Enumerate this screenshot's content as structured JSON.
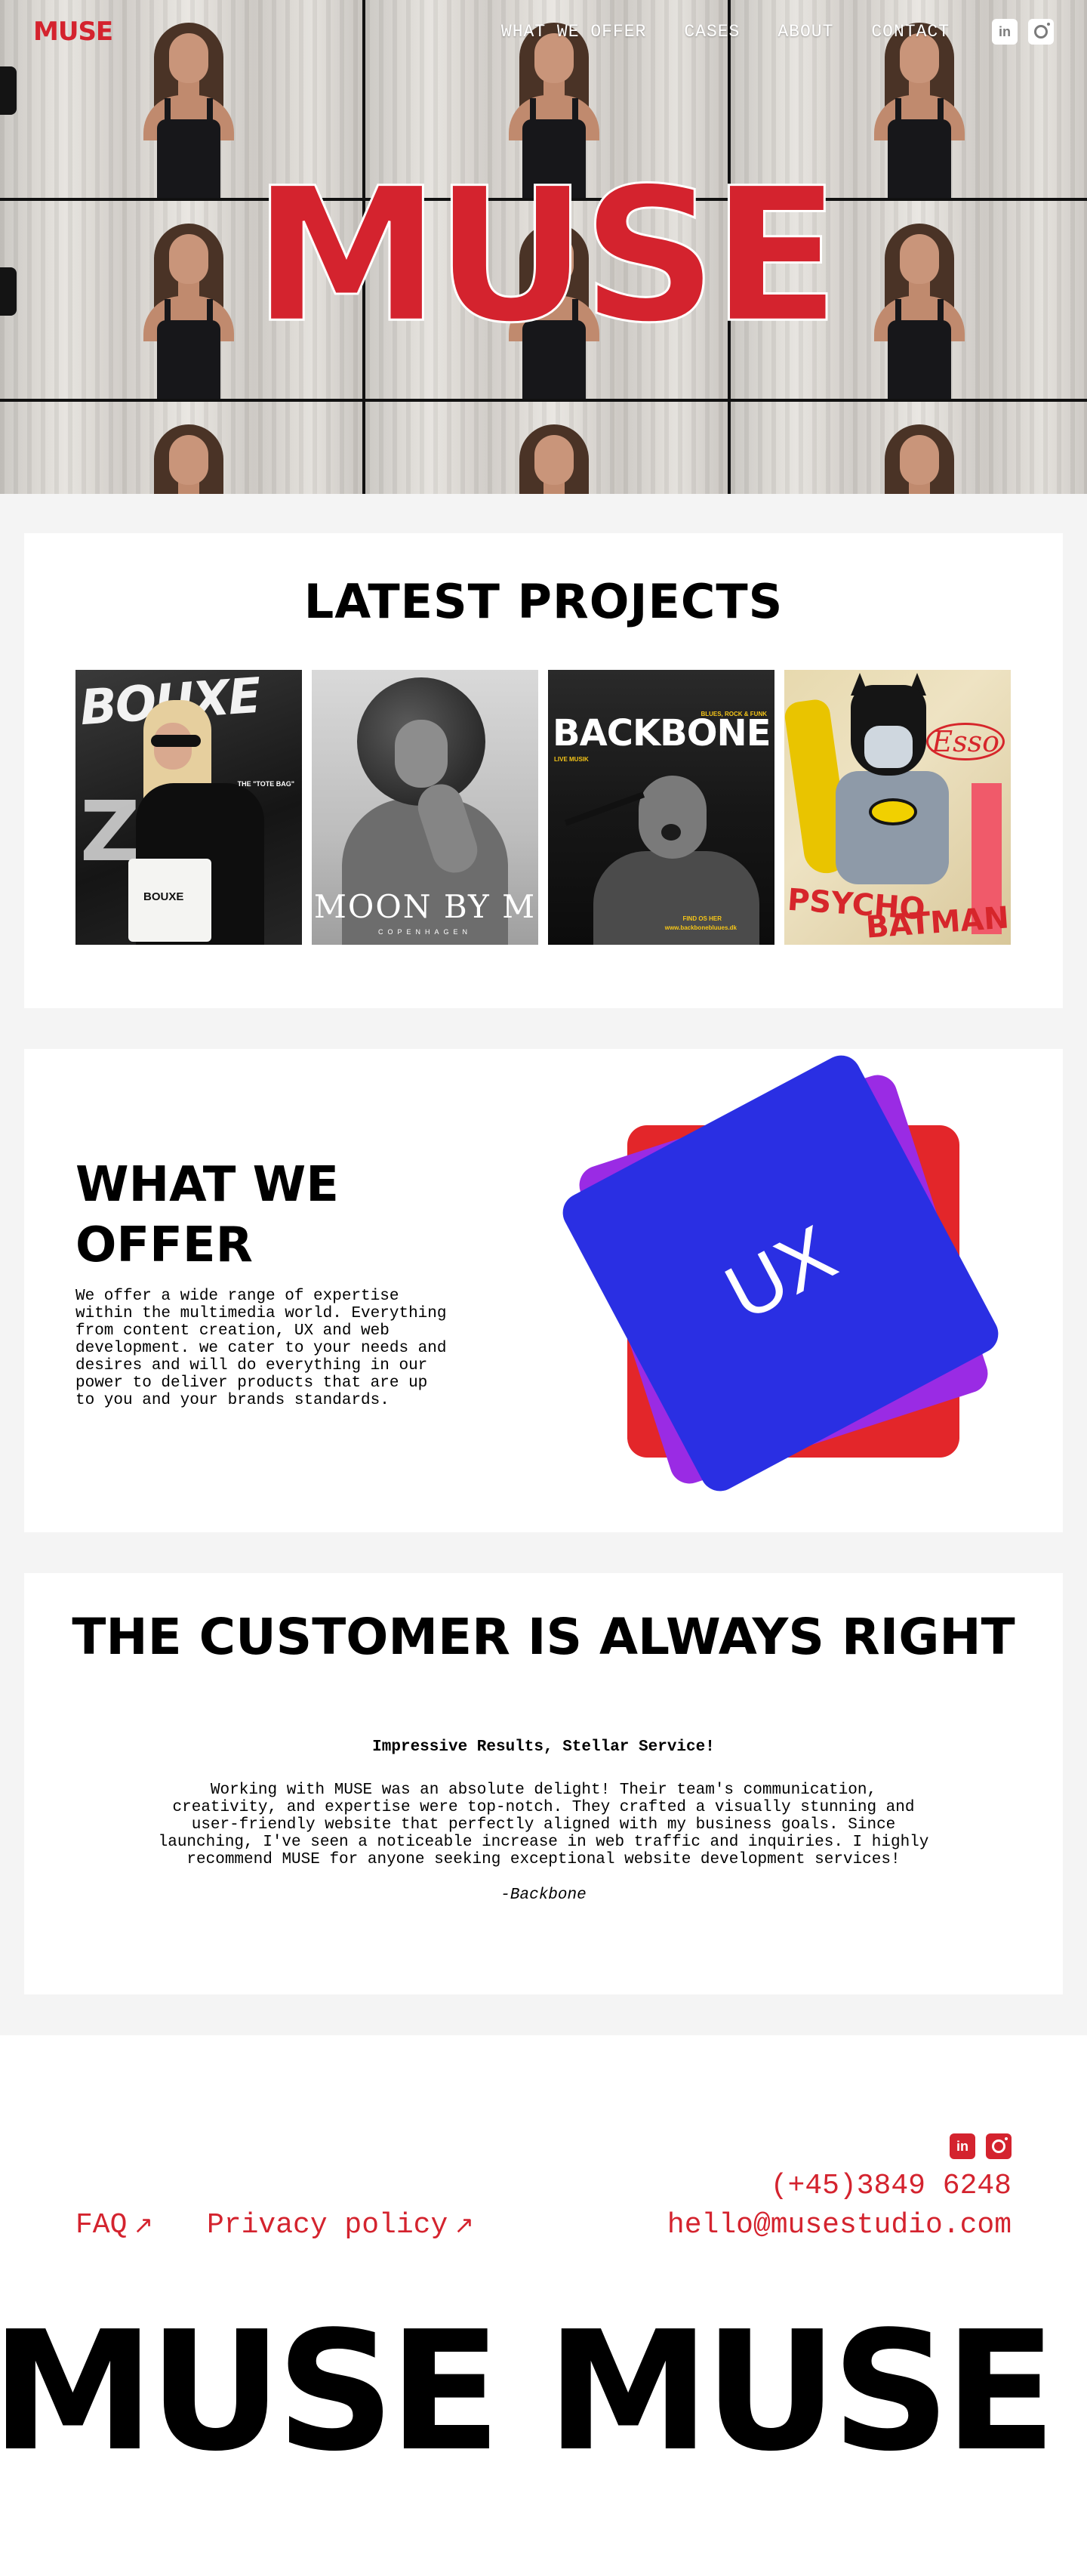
{
  "nav": {
    "logo": "MUSE",
    "links": [
      "WHAT WE OFFER",
      "CASES",
      "ABOUT",
      "CONTACT"
    ],
    "social_icons": [
      "linkedin-icon",
      "instagram-icon"
    ],
    "social_letters": [
      "in",
      ""
    ]
  },
  "hero": {
    "title": "MUSE"
  },
  "projects": {
    "title": "LATEST PROJECTS",
    "items": [
      {
        "name": "Bouxe",
        "big_text": "BOUXE",
        "bag_text": "BOUXE",
        "tag": "THE \"TOTE BAG\""
      },
      {
        "name": "Moon by M",
        "brand": "MOON BY M",
        "sub": "COPENHAGEN"
      },
      {
        "name": "Backbone",
        "title": "BACKBONE",
        "tag": "BLUES, ROCK & FUNK",
        "live": "LIVE MUSIK",
        "find": "FIND OS HER",
        "url": "www.backbonebluues.dk"
      },
      {
        "name": "Psycho Batman",
        "esso": "Esso",
        "psycho": "PSYCHO",
        "batman": "BATMAN"
      }
    ]
  },
  "offer": {
    "title": "WHAT WE OFFER",
    "body": "We offer a wide range of expertise within the multimedia world. Everything from content creation, UX and web development. we cater to your needs and desires and will do everything in our power to deliver products that are up to you and your brands standards.",
    "card_label": "UX"
  },
  "customer": {
    "title": "THE CUSTOMER IS ALWAYS RIGHT",
    "heading": "Impressive Results, Stellar Service!",
    "body": "Working with MUSE was an absolute delight! Their team's communication, creativity, and expertise were top-notch. They crafted a visually stunning and user-friendly website that perfectly aligned with my business goals. Since launching, I've seen a noticeable increase in web traffic and inquiries. I highly recommend MUSE for anyone seeking exceptional website development services!",
    "author": "-Backbone"
  },
  "footer": {
    "faq": "FAQ",
    "privacy": "Privacy policy",
    "arrow": "↗",
    "phone": "(+45)3849 6248",
    "email": "hello@musestudio.com",
    "big_text": "MUSE MUSE MUSE"
  },
  "colors": {
    "brand_red": "#d4232e",
    "blue": "#2a2fe3",
    "purple": "#9a2be4",
    "red": "#e3262a"
  }
}
